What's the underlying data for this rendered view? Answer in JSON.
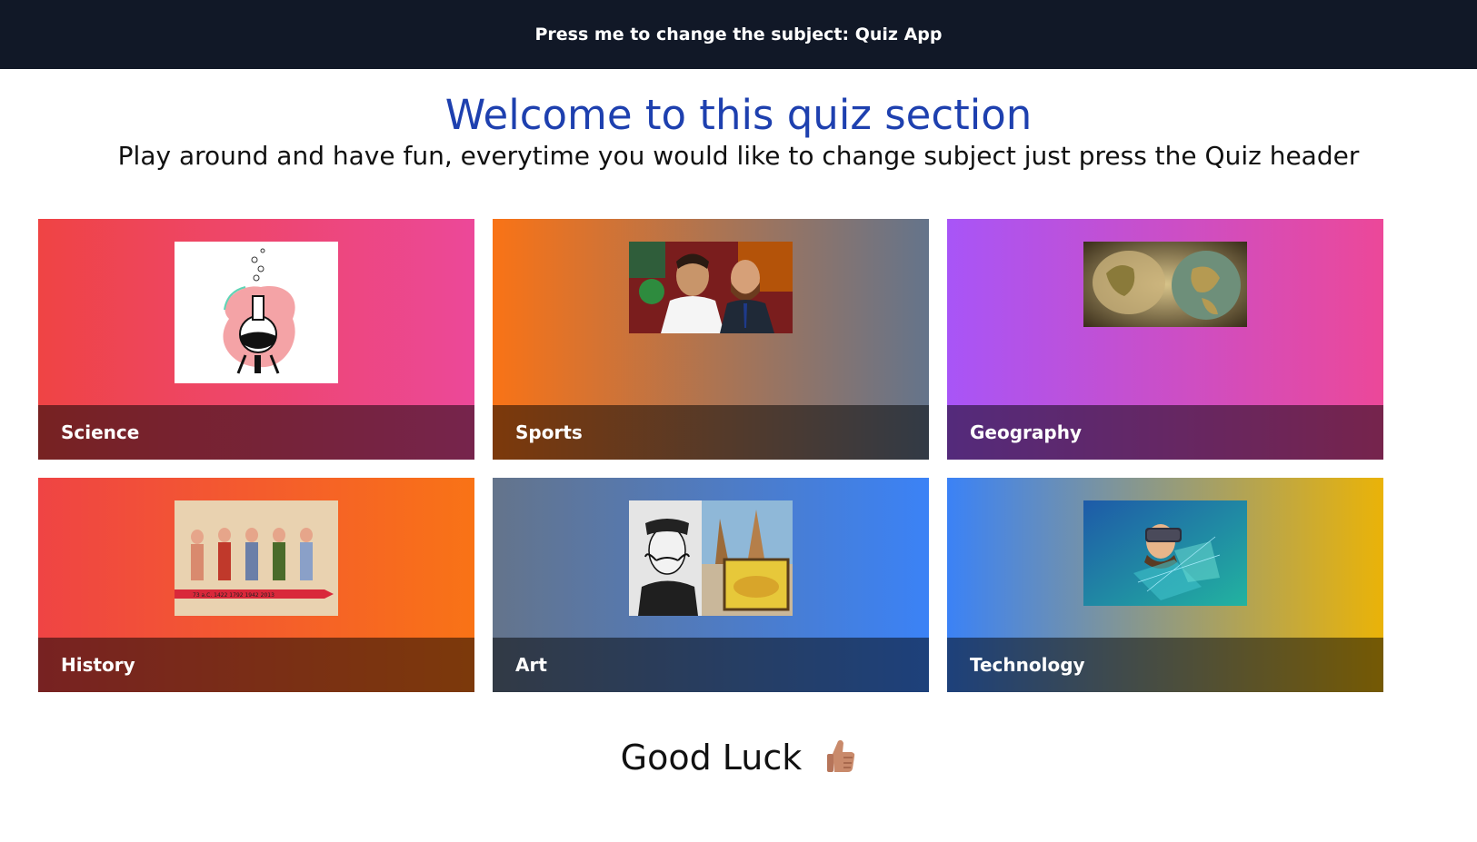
{
  "header": {
    "title": "Press me to change the subject: Quiz App"
  },
  "hero": {
    "title": "Welcome to this quiz section",
    "subtitle": "Play around and have fun, everytime you would like to change subject just press the Quiz header"
  },
  "subjects": [
    {
      "label": "Science",
      "image": "chemistry-flask-illustration"
    },
    {
      "label": "Sports",
      "image": "footballers-cartoon"
    },
    {
      "label": "Geography",
      "image": "antique-world-map-globe"
    },
    {
      "label": "History",
      "image": "historical-soldiers-timeline"
    },
    {
      "label": "Art",
      "image": "dali-surrealist-collage"
    },
    {
      "label": "Technology",
      "image": "vr-headset-illustration"
    }
  ],
  "footer": {
    "text": "Good Luck",
    "icon": "thumbs-up-icon"
  }
}
